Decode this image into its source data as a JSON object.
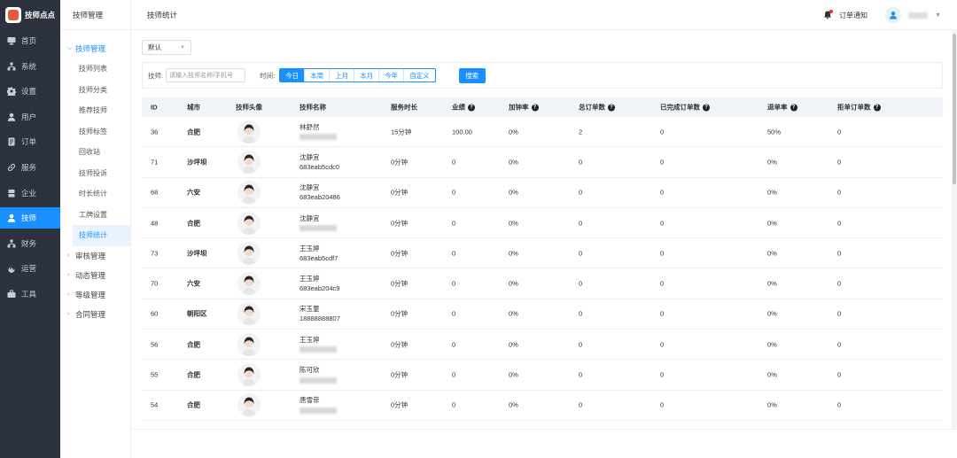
{
  "app": {
    "brand": "技师点点"
  },
  "nav": [
    {
      "label": "首页",
      "icon": "monitor-icon"
    },
    {
      "label": "系统",
      "icon": "sitemap-icon"
    },
    {
      "label": "设置",
      "icon": "gear-icon"
    },
    {
      "label": "用户",
      "icon": "user-icon"
    },
    {
      "label": "订单",
      "icon": "order-icon"
    },
    {
      "label": "服务",
      "icon": "link-icon"
    },
    {
      "label": "企业",
      "icon": "building-icon"
    },
    {
      "label": "技师",
      "icon": "user-icon",
      "active": true
    },
    {
      "label": "财务",
      "icon": "sitemap-icon"
    },
    {
      "label": "运营",
      "icon": "fire-icon"
    },
    {
      "label": "工具",
      "icon": "briefcase-icon"
    }
  ],
  "sub": {
    "header": "技师管理",
    "open_group": "技师管理",
    "items": [
      "技师列表",
      "技师分类",
      "推荐技师",
      "技师标签",
      "回收站",
      "技师投诉",
      "时长统计",
      "工牌设置",
      "技师统计"
    ],
    "active_item": "技师统计",
    "groups": [
      "审核管理",
      "动态管理",
      "等级管理",
      "合同管理"
    ]
  },
  "header": {
    "title": "技师统计",
    "notice": "订单通知"
  },
  "filters": {
    "default_select": "默认",
    "tech_label": "技师:",
    "tech_placeholder": "请输入技师名称/手机号",
    "time_label": "时间:",
    "time_options": [
      "今日",
      "本周",
      "上月",
      "本月",
      "今年",
      "自定义"
    ],
    "time_selected": "今日",
    "search_label": "搜索"
  },
  "table": {
    "columns": [
      "ID",
      "城市",
      "技师头像",
      "技师名称",
      "服务时长",
      "业绩",
      "加钟率",
      "总订单数",
      "已完成订单数",
      "退单率",
      "拒单订单数"
    ],
    "help_columns": [
      "业绩",
      "加钟率",
      "总订单数",
      "已完成订单数",
      "退单率",
      "拒单订单数"
    ],
    "rows": [
      {
        "id": "36",
        "city": "合肥",
        "name": "林舒然",
        "sub": "",
        "duration": "15分钟",
        "perf": "100.00",
        "add_rate": "0%",
        "total": "2",
        "done": "0",
        "refund": "50%",
        "reject": "0"
      },
      {
        "id": "71",
        "city": "沙坪坝",
        "name": "沈静宜",
        "sub": "683eab5cdc0",
        "duration": "0分钟",
        "perf": "0",
        "add_rate": "0%",
        "total": "0",
        "done": "0",
        "refund": "0%",
        "reject": "0"
      },
      {
        "id": "68",
        "city": "六安",
        "name": "沈静宜",
        "sub": "683eab20486",
        "duration": "0分钟",
        "perf": "0",
        "add_rate": "0%",
        "total": "0",
        "done": "0",
        "refund": "0%",
        "reject": "0"
      },
      {
        "id": "48",
        "city": "合肥",
        "name": "沈静宜",
        "sub": "",
        "duration": "0分钟",
        "perf": "0",
        "add_rate": "0%",
        "total": "0",
        "done": "0",
        "refund": "0%",
        "reject": "0"
      },
      {
        "id": "73",
        "city": "沙坪坝",
        "name": "王玉婷",
        "sub": "683eab5cdf7",
        "duration": "0分钟",
        "perf": "0",
        "add_rate": "0%",
        "total": "0",
        "done": "0",
        "refund": "0%",
        "reject": "0"
      },
      {
        "id": "70",
        "city": "六安",
        "name": "王玉婷",
        "sub": "683eab204c9",
        "duration": "0分钟",
        "perf": "0",
        "add_rate": "0%",
        "total": "0",
        "done": "0",
        "refund": "0%",
        "reject": "0"
      },
      {
        "id": "60",
        "city": "朝阳区",
        "name": "宋玉童",
        "sub": "18888888807",
        "duration": "0分钟",
        "perf": "0",
        "add_rate": "0%",
        "total": "0",
        "done": "0",
        "refund": "0%",
        "reject": "0"
      },
      {
        "id": "56",
        "city": "合肥",
        "name": "王玉婷",
        "sub": "",
        "duration": "0分钟",
        "perf": "0",
        "add_rate": "0%",
        "total": "0",
        "done": "0",
        "refund": "0%",
        "reject": "0"
      },
      {
        "id": "55",
        "city": "合肥",
        "name": "陈可欣",
        "sub": "",
        "duration": "0分钟",
        "perf": "0",
        "add_rate": "0%",
        "total": "0",
        "done": "0",
        "refund": "0%",
        "reject": "0"
      },
      {
        "id": "54",
        "city": "合肥",
        "name": "唐雪菲",
        "sub": "",
        "duration": "0分钟",
        "perf": "0",
        "add_rate": "0%",
        "total": "0",
        "done": "0",
        "refund": "0%",
        "reject": "0"
      }
    ]
  },
  "colors": {
    "sidebar": "#2b313d",
    "accent": "#1890ff",
    "header_row": "#f0f3f8"
  }
}
